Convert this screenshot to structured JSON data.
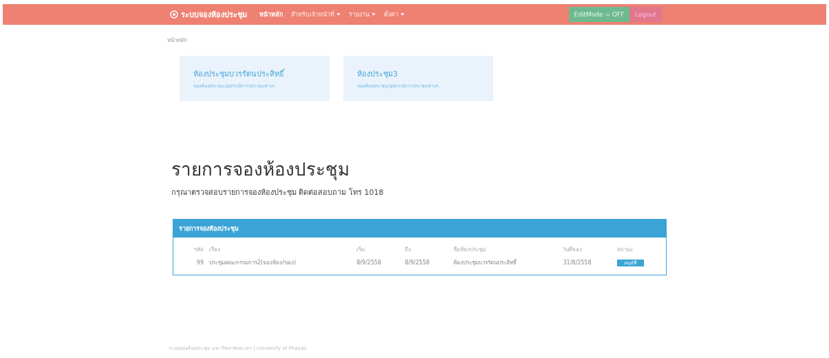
{
  "navbar": {
    "brand": "ระบบจองห้องประชุม",
    "items": [
      {
        "label": "หน้าหลัก",
        "dropdown": false,
        "selected": true
      },
      {
        "label": "สำหรับเจ้าหน้าที่",
        "dropdown": true,
        "selected": false
      },
      {
        "label": "รายงาน",
        "dropdown": true,
        "selected": false
      },
      {
        "label": "ตั้งค่า",
        "dropdown": true,
        "selected": false
      }
    ],
    "edit_mode": "EditMode = OFF",
    "logout": "Logout"
  },
  "breadcrumb": "หน้าหลัก",
  "rooms": [
    {
      "title": "ห้องประชุมบวรรัตนประสิทธิ์",
      "subtitle": "จองห้องประชุม/อุปกรณ์การประชุมต่างๆ"
    },
    {
      "title": "ห้องประชุม3",
      "subtitle": "จองห้องประชุม/อุปกรณ์การประชุมต่างๆ"
    }
  ],
  "heading": "รายการจองห้องประชุม",
  "subheading": "กรุณาตรวจสอบรายการจองห้องประชุม ติดต่อสอบถาม โทร 1018",
  "panel": {
    "title": "รายการจองห้องประชุม",
    "columns": [
      "รหัส",
      "เรื่อง",
      "เริ่ม",
      "ถึง",
      "ชื่อห้องประชุม",
      "วันที่จอง",
      "สถานะ"
    ],
    "rows": [
      {
        "id": "99",
        "subject": "ประชุมคณะกรรมการ2(จองห้อง/ของ)",
        "start": "8/9/2558",
        "end": "8/9/2558",
        "room": "ห้องประชุมบวรรัตนประสิทธิ์",
        "booked": "31/8/2558",
        "status": "อนุมัติ"
      }
    ]
  },
  "footer": "ระบบจองห้องประชุม มหาวิทยาลัยพะเยา | University of Phayao"
}
